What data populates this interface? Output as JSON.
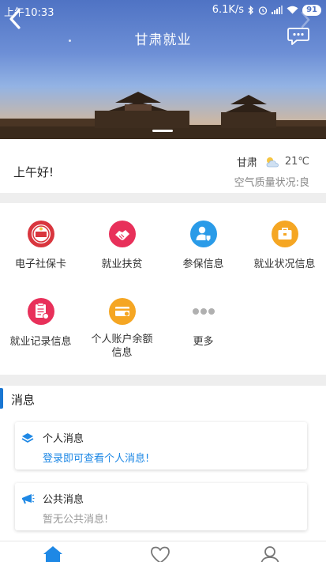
{
  "status_bar": {
    "time": "上午10:33",
    "net_speed": "6.1K/s",
    "battery": "91"
  },
  "header": {
    "title": "甘肃就业",
    "icons": [
      "back-arrow-icon",
      "forward-arrow-icon",
      "chat-bubble-icon"
    ]
  },
  "greeting": {
    "text": "上午好!",
    "city": "甘肃",
    "temperature": "21℃",
    "weather_icon": "partly-cloudy-icon",
    "air_quality": "空气质量状况:良"
  },
  "services": [
    {
      "label": "电子社保卡",
      "icon": "social-security-card-icon",
      "color": "#d9363e"
    },
    {
      "label": "就业扶贫",
      "icon": "handshake-icon",
      "color": "#e8305a"
    },
    {
      "label": "参保信息",
      "icon": "person-insured-icon",
      "color": "#2a9be8"
    },
    {
      "label": "就业状况信息",
      "icon": "briefcase-icon",
      "color": "#f5a623"
    },
    {
      "label": "就业记录信息",
      "icon": "record-document-icon",
      "color": "#e8305a"
    },
    {
      "label": "个人账户余额信息",
      "label_lines": [
        "个人账户余额",
        "信息"
      ],
      "icon": "account-balance-card-icon",
      "color": "#f5a623"
    },
    {
      "label": "更多",
      "icon": "more-dots-icon",
      "color": "#b0b0b0"
    }
  ],
  "messages": {
    "title": "消息",
    "accent_color": "#1976d2",
    "items": [
      {
        "title": "个人消息",
        "body": "登录即可查看个人消息!",
        "icon": "personal-message-icon"
      },
      {
        "title": "公共消息",
        "body": "暂无公共消息!",
        "icon": "public-announcement-icon"
      }
    ]
  },
  "bottom_nav": {
    "active_color": "#1e88e5",
    "items": [
      {
        "icon": "home-icon",
        "active": true
      },
      {
        "icon": "heart-icon",
        "active": false
      },
      {
        "icon": "profile-icon",
        "active": false
      }
    ]
  }
}
